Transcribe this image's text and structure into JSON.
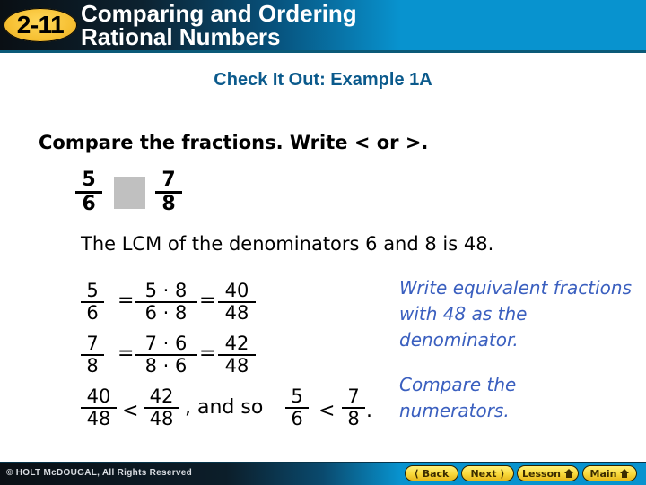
{
  "header": {
    "lesson_badge": "2-11",
    "title_line1": "Comparing and Ordering",
    "title_line2": "Rational Numbers",
    "colors": {
      "badge": "#f6c033",
      "bar": "#0893cf"
    }
  },
  "subtitle": "Check It Out: Example 1A",
  "prompt": "Compare the fractions. Write < or >.",
  "problem": {
    "left": {
      "num": "5",
      "den": "6"
    },
    "right": {
      "num": "7",
      "den": "8"
    },
    "answer_box_color": "#c0c0c0"
  },
  "lcm_text": "The LCM of the denominators 6 and 8 is 48.",
  "steps": {
    "row1": {
      "a": {
        "num": "5",
        "den": "6"
      },
      "eq1": "=",
      "b": {
        "num": "5 · 8",
        "den": "6 · 8"
      },
      "eq2": "=",
      "c": {
        "num": "40",
        "den": "48"
      }
    },
    "row2": {
      "a": {
        "num": "7",
        "den": "8"
      },
      "eq1": "=",
      "b": {
        "num": "7 · 6",
        "den": "8 · 6"
      },
      "eq2": "=",
      "c": {
        "num": "42",
        "den": "48"
      }
    },
    "conclusion": {
      "a": {
        "num": "40",
        "den": "48"
      },
      "lt1": "<",
      "b": {
        "num": "42",
        "den": "48"
      },
      "mid": ", and so",
      "c": {
        "num": "5",
        "den": "6"
      },
      "lt2": "<",
      "d": {
        "num": "7",
        "den": "8"
      },
      "end": "."
    }
  },
  "notes": {
    "equivalent": "Write equivalent fractions with 48 as the denominator.",
    "compare": "Compare the numerators."
  },
  "footer": {
    "copyright": "© HOLT McDOUGAL, All Rights Reserved",
    "nav": [
      {
        "label": "Back",
        "icon": "chevron-left-icon"
      },
      {
        "label": "Next",
        "icon": "chevron-right-icon"
      },
      {
        "label": "Lesson",
        "icon": "home-icon"
      },
      {
        "label": "Main",
        "icon": "home-icon"
      }
    ]
  }
}
